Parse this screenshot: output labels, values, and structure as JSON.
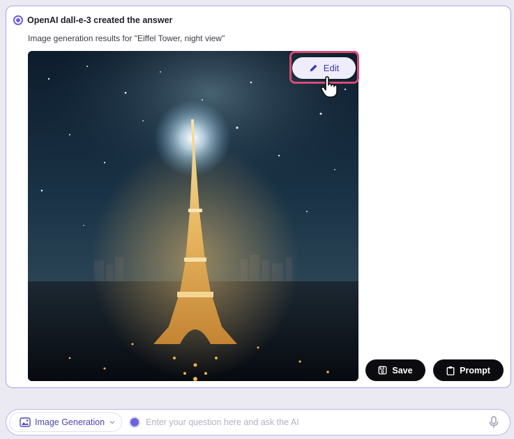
{
  "answer": {
    "title": "OpenAI dall-e-3 created the answer",
    "subtitle": "Image generation results for \"Eiffel Tower, night view\"",
    "image_alt": "Eiffel Tower, night view"
  },
  "image_overlay": {
    "edit_label": "Edit"
  },
  "actions": {
    "save_label": "Save",
    "prompt_label": "Prompt"
  },
  "input_bar": {
    "mode_label": "Image Generation",
    "placeholder": "Enter your question here and ask the AI"
  },
  "icons": {
    "radio": "radio-selected-icon",
    "edit": "pencil-icon",
    "cursor": "hand-pointer-icon",
    "save": "floppy-disk-icon",
    "prompt": "clipboard-icon",
    "mode": "image-ai-icon",
    "dropdown": "chevron-down-icon",
    "mic": "microphone-icon"
  },
  "colors": {
    "accent": "#6c63e0",
    "highlight": "#d94a75",
    "button_dark": "#0c0c10"
  }
}
